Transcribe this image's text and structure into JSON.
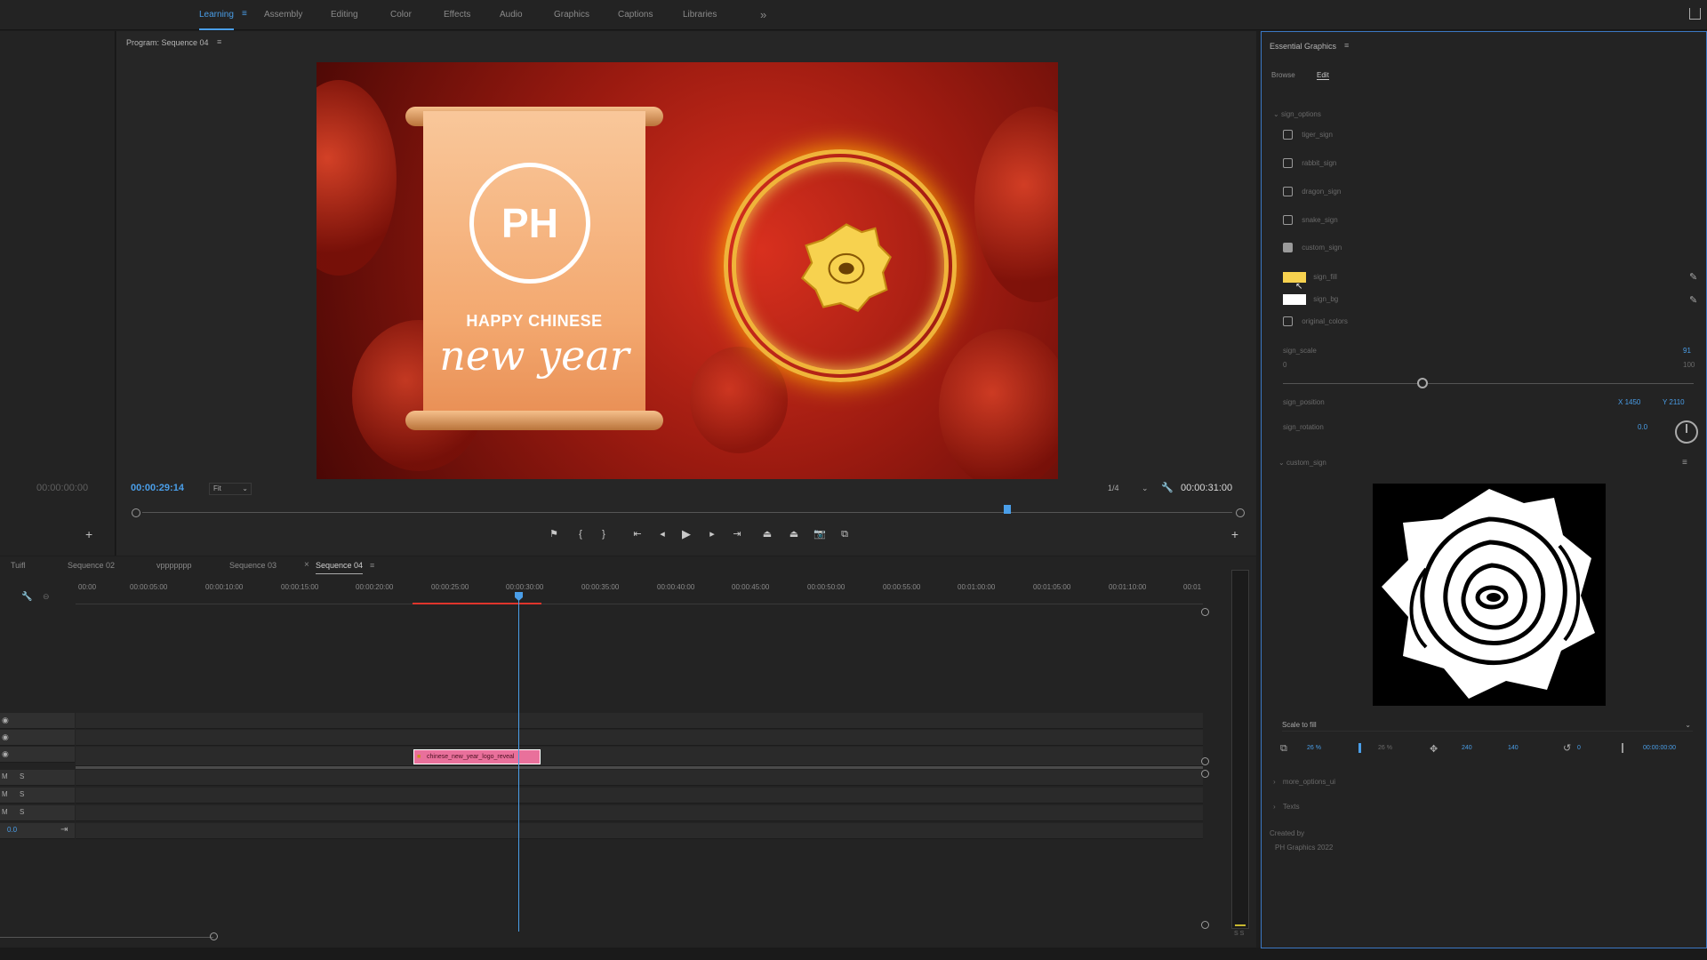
{
  "workspaces": {
    "tabs": [
      "Learning",
      "Assembly",
      "Editing",
      "Color",
      "Effects",
      "Audio",
      "Graphics",
      "Captions",
      "Libraries"
    ],
    "active": "Learning",
    "overflow": "»"
  },
  "program": {
    "title": "Program: Sequence 04",
    "source_tc": "00:00:00:00",
    "current_tc": "00:00:29:14",
    "fit": "Fit",
    "resolution": "1/4",
    "duration_tc": "00:00:31:00",
    "playhead_pos": 0.79
  },
  "video": {
    "logo": "PH",
    "line1": "HAPPY CHINESE",
    "line2": "new year"
  },
  "colors": {
    "accent": "#4a9ee8",
    "clip": "#e9709b",
    "in_out": "#e0352c",
    "gold": "#f7d24f"
  },
  "timeline": {
    "tabs": [
      "Tuifl",
      "Sequence 02",
      "vppppppp",
      "Sequence 03",
      "Sequence 04"
    ],
    "active_tab": "Sequence 04",
    "ruler": [
      "00:00",
      "00:00:05:00",
      "00:00:10:00",
      "00:00:15:00",
      "00:00:20:00",
      "00:00:25:00",
      "00:00:30:00",
      "00:00:35:00",
      "00:00:40:00",
      "00:00:45:00",
      "00:00:50:00",
      "00:00:55:00",
      "00:01:00:00",
      "00:01:05:00",
      "00:01:10:00",
      "00:01"
    ],
    "clip_label": "chinese_new_year_logo_reveal",
    "audio_track_labels": [
      "M",
      "S",
      "M",
      "S",
      "M",
      "S"
    ],
    "master_value": "0.0",
    "meter_label": "S S"
  },
  "essential_graphics": {
    "title": "Essential Graphics",
    "tabs": [
      "Browse",
      "Edit"
    ],
    "active_tab": "Edit",
    "section": "sign_options",
    "checkboxes": [
      {
        "label": "tiger_sign",
        "checked": false
      },
      {
        "label": "rabbit_sign",
        "checked": false
      },
      {
        "label": "dragon_sign",
        "checked": false
      },
      {
        "label": "snake_sign",
        "checked": false
      },
      {
        "label": "custom_sign",
        "checked": true
      }
    ],
    "colors": [
      {
        "label": "sign_fill",
        "value": "#f7d24f"
      },
      {
        "label": "sign_bg",
        "value": "#ffffff"
      }
    ],
    "extra_checkbox": "original_colors",
    "scale": {
      "label": "sign_scale",
      "value": "91",
      "min": "0",
      "max": "100",
      "level": 0.34
    },
    "position": {
      "label": "sign_position",
      "x": "1450",
      "y": "2110"
    },
    "rotation": {
      "label": "sign_rotation",
      "value": "0.0"
    },
    "custom_section": "custom_sign",
    "scale_mode": "Scale to fill",
    "transform": {
      "w": "26 %",
      "h": "26 %",
      "x": "240",
      "y": "140",
      "rot": "0",
      "time": "00:00:00:00"
    },
    "collapsed": [
      "more_options_ui",
      "Texts"
    ],
    "credit_line1": "Created by",
    "credit_line2": "PH Graphics 2022"
  }
}
